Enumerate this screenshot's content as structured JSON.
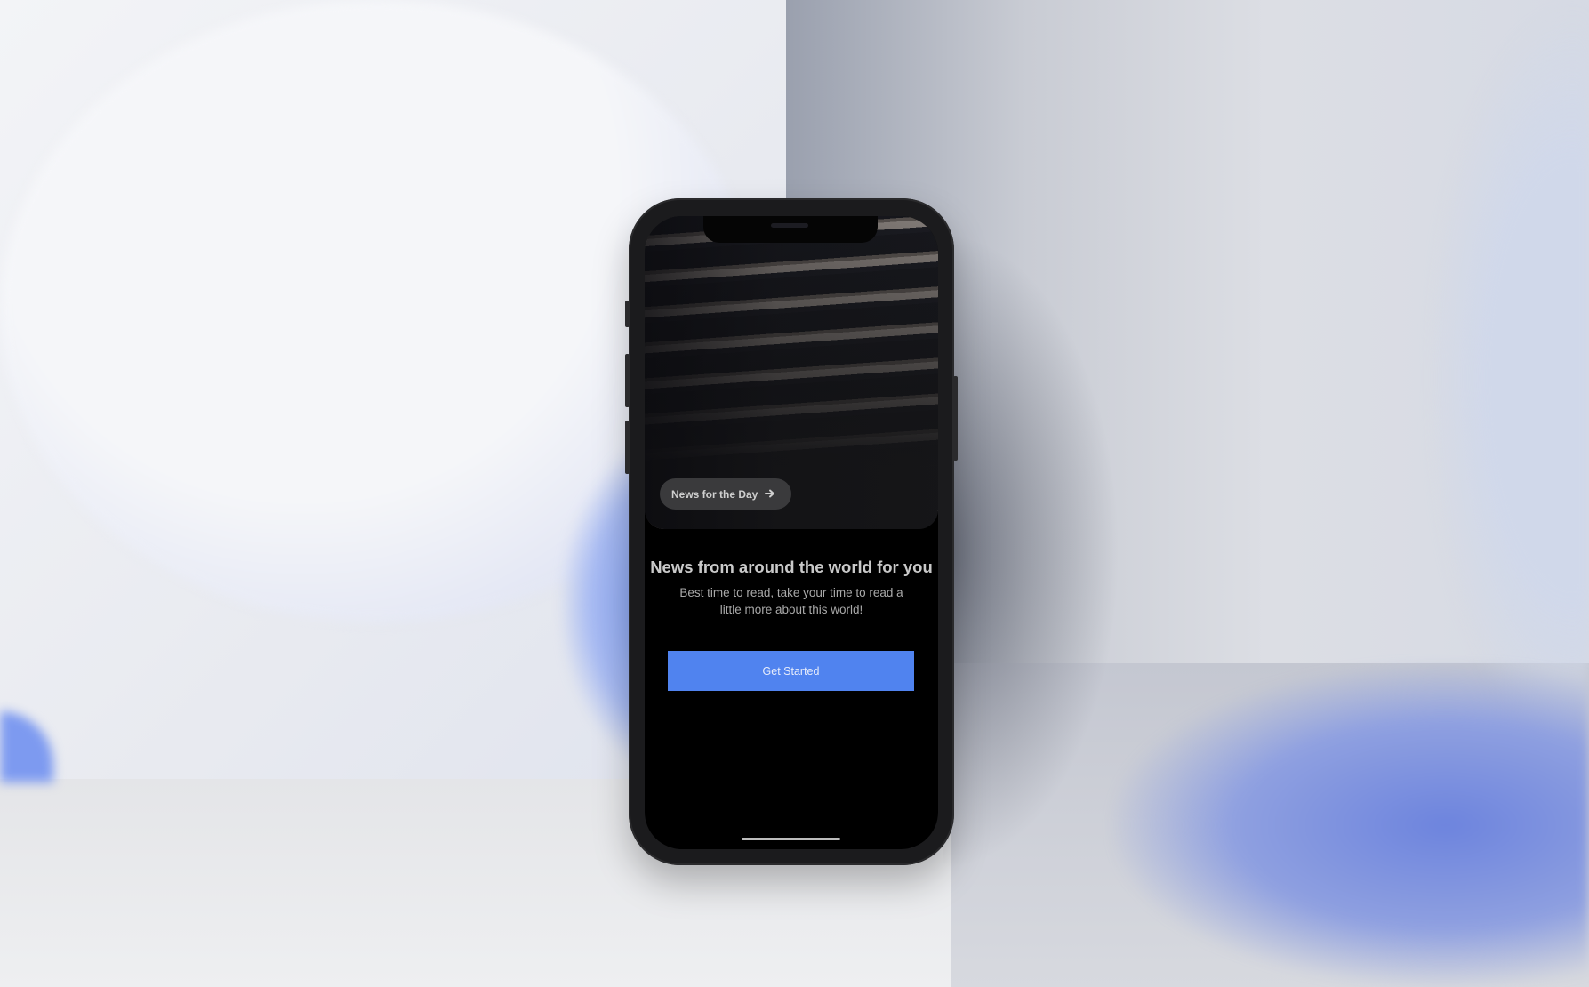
{
  "hero": {
    "badge_label": "News for the Day",
    "badge_icon": "arrow-right-icon"
  },
  "onboarding": {
    "title": "News from around the world for you",
    "subtitle": "Best time to read, take your time to read a little more about this world!",
    "cta_label": "Get Started"
  },
  "colors": {
    "accent": "#5083ef",
    "screen_bg": "#000000",
    "badge_bg": "#3a3a3c"
  }
}
